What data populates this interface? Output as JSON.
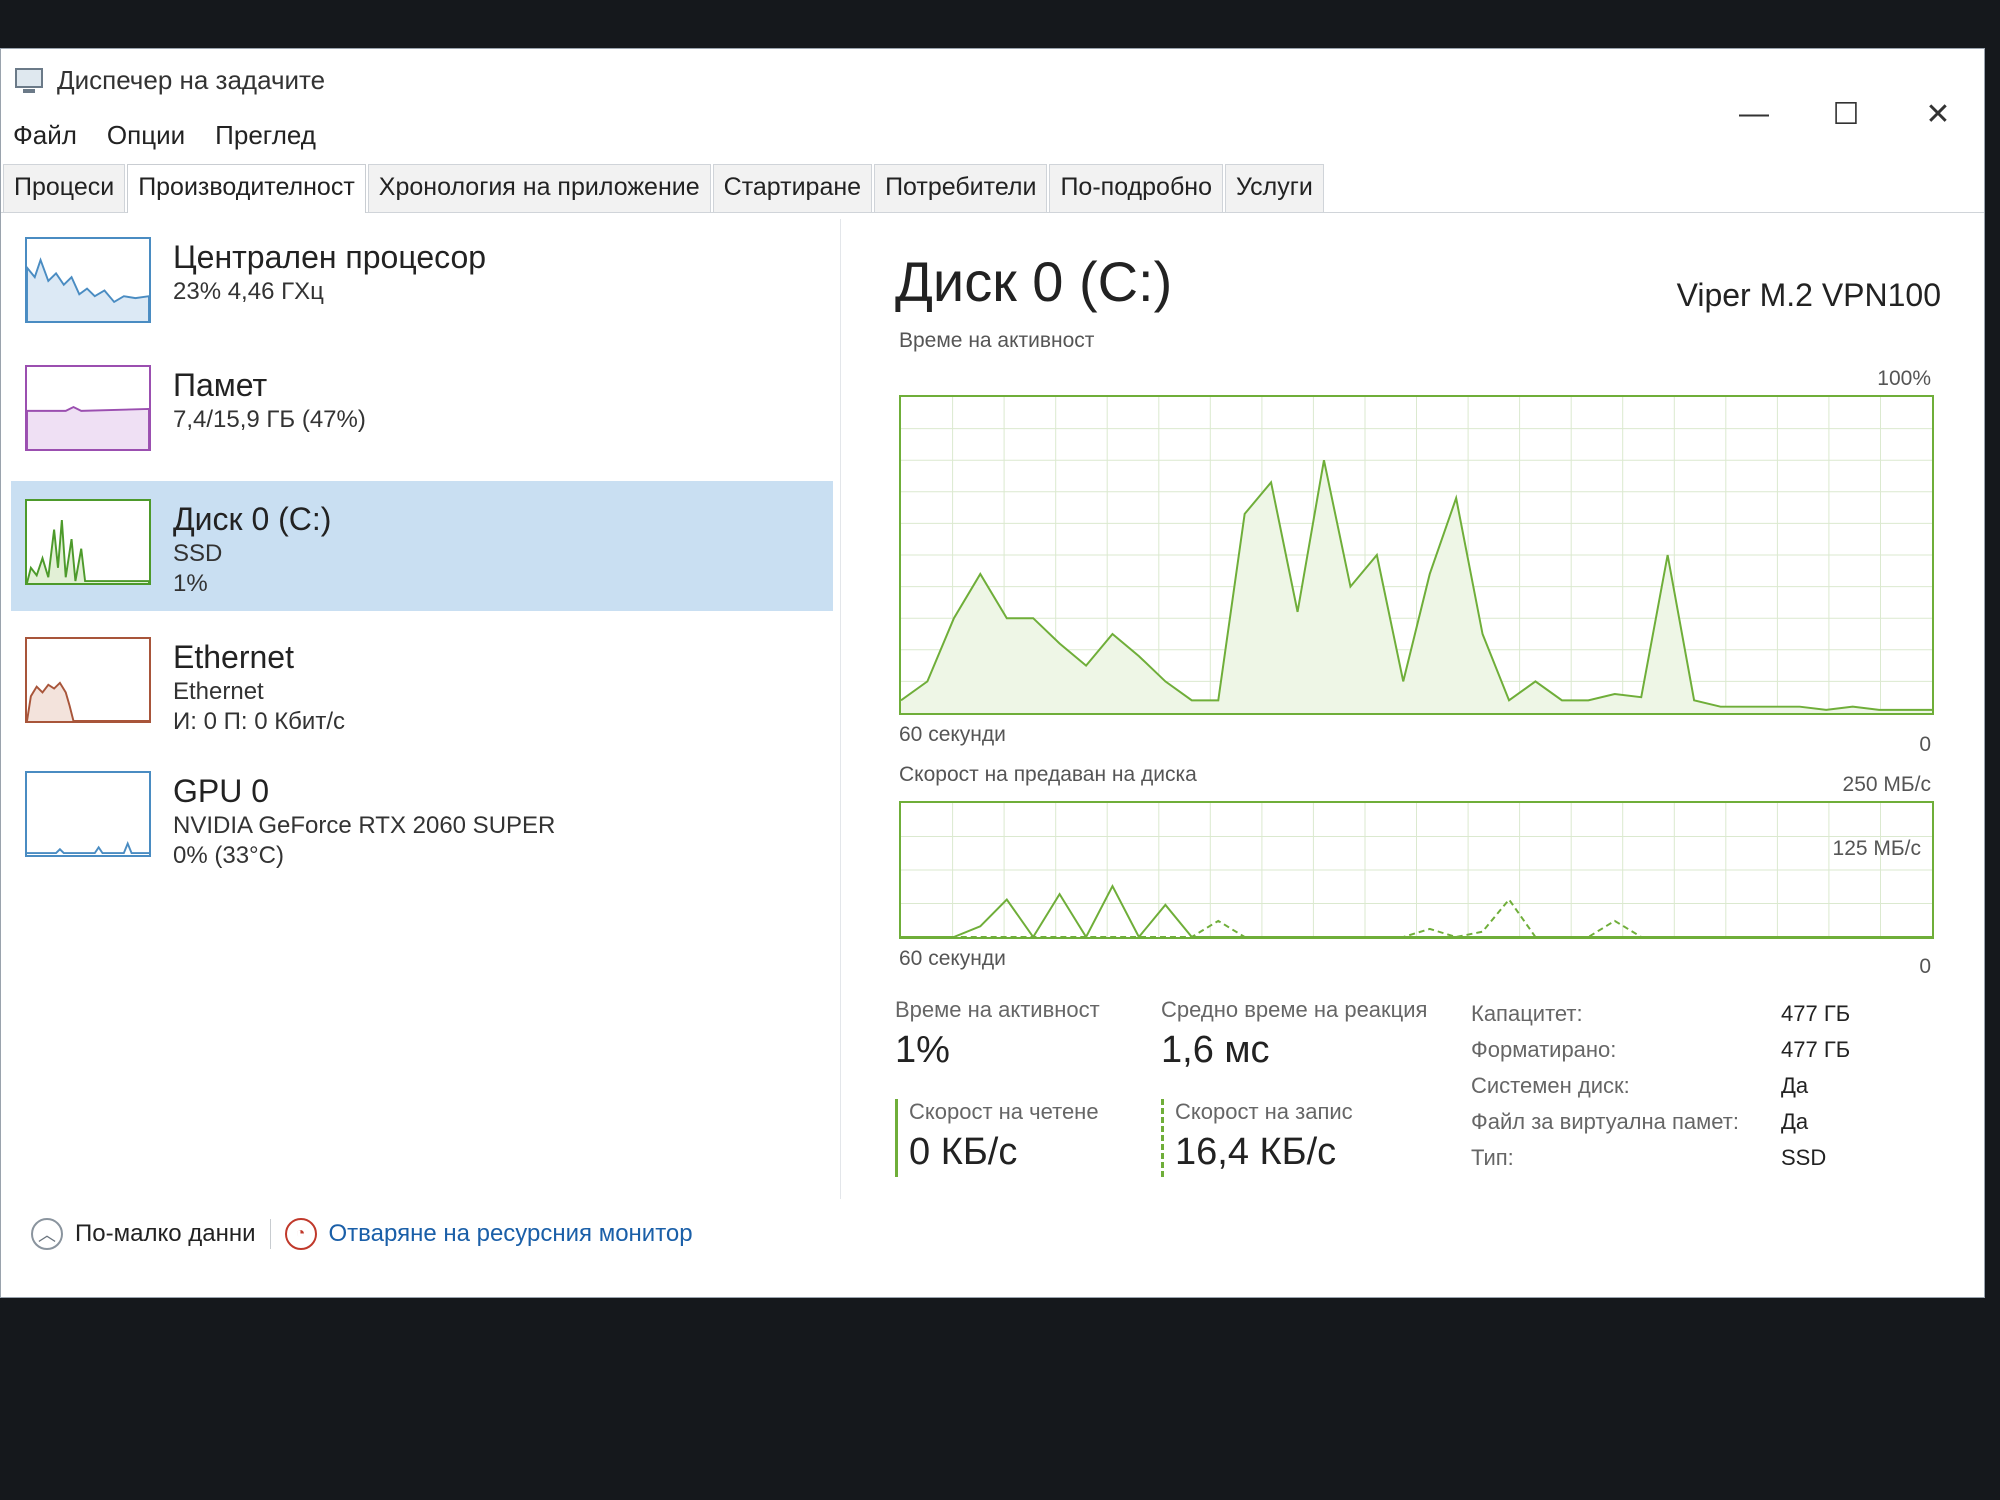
{
  "window": {
    "title": "Диспечер на задачите",
    "controls": {
      "minimize": "—",
      "maximize": "☐",
      "close": "✕"
    }
  },
  "menu": [
    "Файл",
    "Опции",
    "Преглед"
  ],
  "tabs": [
    "Процеси",
    "Производителност",
    "Хронология на приложение",
    "Стартиране",
    "Потребители",
    "По-подробно",
    "Услуги"
  ],
  "active_tab": "Производителност",
  "sidebar": {
    "items": [
      {
        "title": "Централен процесор",
        "line1": "23%  4,46 ГХц",
        "line2": "",
        "color": "#4a8cc2"
      },
      {
        "title": "Памет",
        "line1": "7,4/15,9 ГБ (47%)",
        "line2": "",
        "color": "#9b4fb0"
      },
      {
        "title": "Диск 0 (C:)",
        "line1": "SSD",
        "line2": "1%",
        "color": "#4d9a2b"
      },
      {
        "title": "Ethernet",
        "line1": "Ethernet",
        "line2": "И: 0 П: 0 Кбит/с",
        "color": "#a8553a"
      },
      {
        "title": "GPU 0",
        "line1": "NVIDIA GeForce RTX 2060 SUPER",
        "line2": "0%  (33°C)",
        "color": "#4a8cc2"
      }
    ],
    "selected_index": 2
  },
  "main": {
    "title": "Диск 0 (C:)",
    "model": "Viper M.2 VPN100",
    "active_graph": {
      "label": "Време на активност",
      "max_label": "100%",
      "time_label": "60 секунди",
      "min_label": "0",
      "values_percent": [
        4,
        10,
        30,
        44,
        30,
        30,
        22,
        15,
        25,
        18,
        10,
        4,
        4,
        63,
        73,
        32,
        80,
        40,
        50,
        10,
        44,
        68,
        25,
        4,
        10,
        4,
        4,
        6,
        5,
        50,
        4,
        2,
        2,
        2,
        2,
        1,
        2,
        1,
        1,
        1
      ]
    },
    "transfer_graph": {
      "label": "Скорост на предаван на диска",
      "max_label": "250 МБ/с",
      "mid_label": "125 МБ/с",
      "time_label": "60 секунди",
      "min_label": "0",
      "read_mbps": [
        0,
        0,
        0,
        20,
        70,
        0,
        80,
        0,
        95,
        0,
        60,
        0,
        0,
        0,
        0,
        0,
        0,
        0,
        0,
        0,
        0,
        0,
        0,
        0,
        0,
        0,
        0,
        0,
        0,
        0,
        0,
        0,
        0,
        0,
        0,
        0,
        0,
        0,
        0,
        0
      ],
      "write_mbps": [
        0,
        0,
        0,
        0,
        0,
        0,
        0,
        0,
        0,
        0,
        0,
        0,
        30,
        0,
        0,
        0,
        0,
        0,
        0,
        0,
        15,
        0,
        10,
        70,
        0,
        0,
        0,
        30,
        0,
        0,
        0,
        0,
        0,
        0,
        0,
        0,
        0,
        0,
        0,
        0
      ],
      "scale_max_mbps": 250
    },
    "stats": {
      "active_time_label": "Време на активност",
      "active_time_value": "1%",
      "response_label": "Средно време на реакция",
      "response_value": "1,6 мс",
      "read_label": "Скорост на четене",
      "read_value": "0 КБ/с",
      "write_label": "Скорост на запис",
      "write_value": "16,4 КБ/с"
    },
    "properties": [
      {
        "key": "Капацитет:",
        "value": "477 ГБ"
      },
      {
        "key": "Форматирано:",
        "value": "477 ГБ"
      },
      {
        "key": "Системен диск:",
        "value": "Да"
      },
      {
        "key": "Файл за виртуална памет:",
        "value": "Да"
      },
      {
        "key": "Тип:",
        "value": "SSD"
      }
    ]
  },
  "footer": {
    "fewer_details": "По-малко данни",
    "open_monitor": "Отваряне на ресурсния монитор"
  },
  "colors": {
    "graph_green": "#6fae39",
    "grid": "#dbe9cf",
    "selection": "#c9dff2",
    "link": "#1a5fa8"
  }
}
